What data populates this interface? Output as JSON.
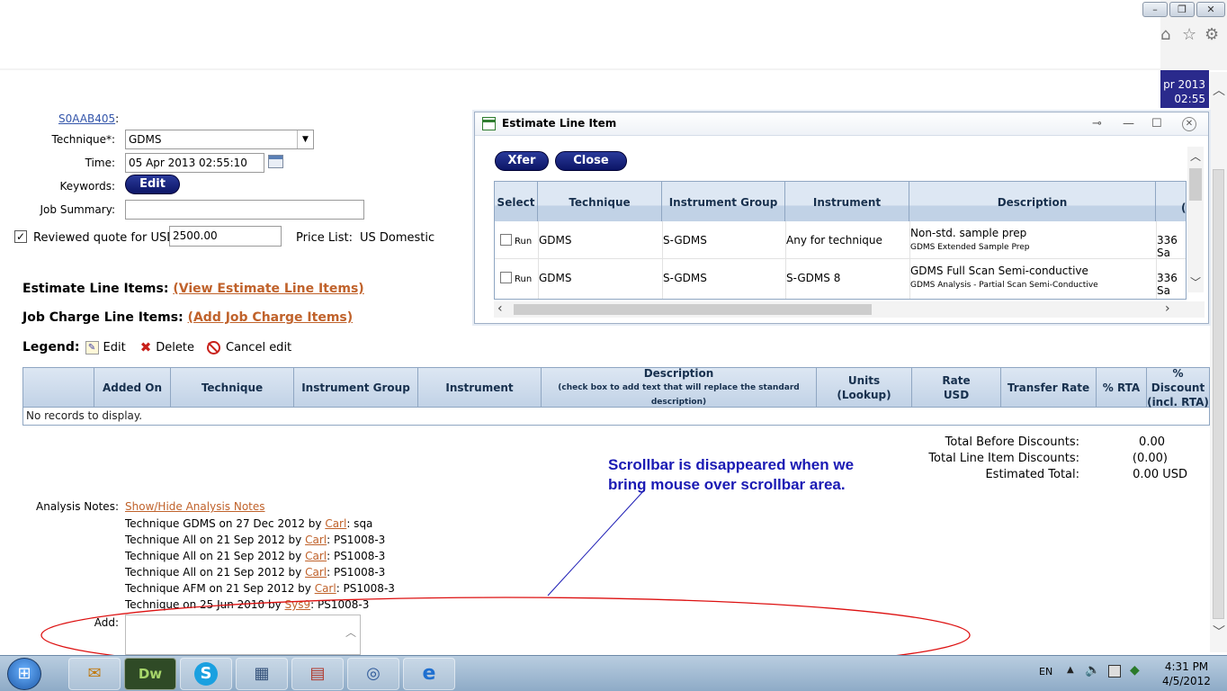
{
  "browser": {
    "window_controls": [
      "–",
      "❐",
      "✕"
    ],
    "tool_icons": [
      "home-icon",
      "star-icon",
      "gear-icon"
    ],
    "date_line1": "pr 2013",
    "date_line2": "02:55"
  },
  "form": {
    "id_link": "S0AAB405",
    "id_colon": ":",
    "technique_label": "Technique*:",
    "technique_value": "GDMS",
    "time_label": "Time:",
    "time_value": "05 Apr 2013 02:55:10",
    "keywords_label": "Keywords:",
    "edit_button": "Edit",
    "job_summary_label": "Job Summary:",
    "job_summary_value": "",
    "reviewed_label": "Reviewed quote for USD",
    "reviewed_checked": true,
    "quote_value": "2500.00",
    "price_list_label": "Price List:",
    "price_list_value": "US Domestic"
  },
  "sections": {
    "estimate_label": "Estimate Line Items:",
    "estimate_link": "(View Estimate Line Items)",
    "job_charge_label": "Job Charge Line Items:",
    "job_charge_link": "(Add Job Charge Items)",
    "legend_label": "Legend:",
    "legend_edit": "Edit",
    "legend_delete": "Delete",
    "legend_cancel": "Cancel edit"
  },
  "grid": {
    "columns": [
      {
        "label": "",
        "sub": ""
      },
      {
        "label": "Added On",
        "sub": ""
      },
      {
        "label": "Technique",
        "sub": ""
      },
      {
        "label": "Instrument Group",
        "sub": ""
      },
      {
        "label": "Instrument",
        "sub": ""
      },
      {
        "label": "Description",
        "sub": "(check box to add text that will replace the standard description)"
      },
      {
        "label": "Units",
        "sub": "(Lookup)"
      },
      {
        "label": "Rate",
        "sub": "USD"
      },
      {
        "label": "Transfer Rate",
        "sub": ""
      },
      {
        "label": "% RTA",
        "sub": ""
      },
      {
        "label": "% Discount",
        "sub": "(incl. RTA)"
      }
    ],
    "empty_text": "No records to display."
  },
  "totals": {
    "before_label": "Total Before Discounts:",
    "before_value": "0.00",
    "line_label": "Total Line Item Discounts:",
    "line_value": "(0.00)",
    "est_label": "Estimated Total:",
    "est_value": "0.00 USD"
  },
  "annotation": {
    "line1": "Scrollbar is disappeared when we",
    "line2": "bring mouse over scrollbar area."
  },
  "notes": {
    "label": "Analysis Notes:",
    "toggle_link": "Show/Hide Analysis Notes",
    "items": [
      {
        "pre": "Technique GDMS on 27 Dec 2012 by ",
        "user": "Carl",
        "post": ": sqa"
      },
      {
        "pre": "Technique All on 21 Sep 2012 by ",
        "user": "Carl",
        "post": ": PS1008-3"
      },
      {
        "pre": "Technique All on 21 Sep 2012 by ",
        "user": "Carl",
        "post": ": PS1008-3"
      },
      {
        "pre": "Technique All on 21 Sep 2012 by ",
        "user": "Carl",
        "post": ": PS1008-3"
      },
      {
        "pre": "Technique AFM on 21 Sep 2012 by ",
        "user": "Carl",
        "post": ": PS1008-3"
      },
      {
        "pre": "Technique on 25 Jun 2010 by ",
        "user": "Sys9",
        "post": ": PS1008-3"
      }
    ],
    "add_label": "Add:"
  },
  "dialog": {
    "title": "Estimate Line Item",
    "xfer_button": "Xfer",
    "close_button": "Close",
    "headers": [
      "Select",
      "Technique",
      "Instrument Group",
      "Instrument",
      "Description",
      "(l"
    ],
    "rows": [
      {
        "run": "Run",
        "technique": "GDMS",
        "group": "S-GDMS",
        "instrument": "Any for technique",
        "desc": "Non-std. sample prep",
        "desc_sub": "GDMS Extended Sample Prep",
        "last": "336 Sa"
      },
      {
        "run": "Run",
        "technique": "GDMS",
        "group": "S-GDMS",
        "instrument": "S-GDMS 8",
        "desc": "GDMS Full Scan Semi-conductive",
        "desc_sub": "GDMS Analysis - Partial Scan Semi-Conductive",
        "last": "336 Sa"
      }
    ]
  },
  "taskbar": {
    "start": "⊞",
    "apps": [
      "✉",
      "Dw",
      "S",
      "▦",
      "▤",
      "◎",
      "e"
    ],
    "lang": "EN",
    "time": "4:31 PM",
    "date": "4/5/2012"
  }
}
